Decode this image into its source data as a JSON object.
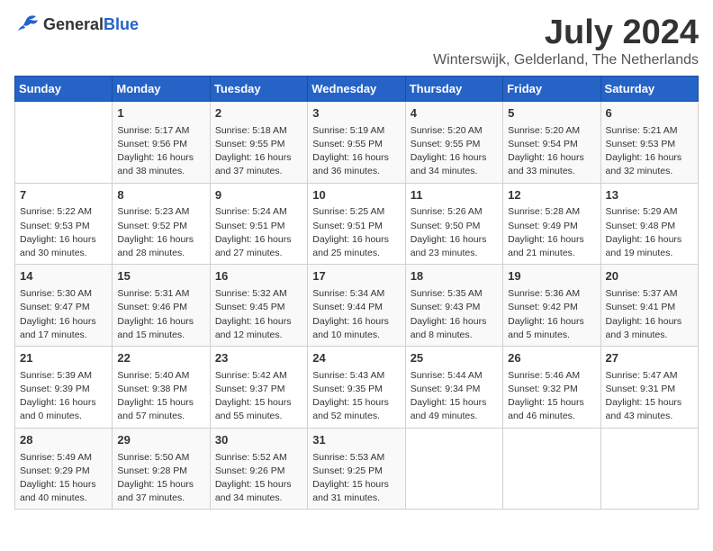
{
  "logo": {
    "general": "General",
    "blue": "Blue"
  },
  "title": "July 2024",
  "subtitle": "Winterswijk, Gelderland, The Netherlands",
  "days_header": [
    "Sunday",
    "Monday",
    "Tuesday",
    "Wednesday",
    "Thursday",
    "Friday",
    "Saturday"
  ],
  "weeks": [
    [
      {
        "day": "",
        "info": ""
      },
      {
        "day": "1",
        "info": "Sunrise: 5:17 AM\nSunset: 9:56 PM\nDaylight: 16 hours\nand 38 minutes."
      },
      {
        "day": "2",
        "info": "Sunrise: 5:18 AM\nSunset: 9:55 PM\nDaylight: 16 hours\nand 37 minutes."
      },
      {
        "day": "3",
        "info": "Sunrise: 5:19 AM\nSunset: 9:55 PM\nDaylight: 16 hours\nand 36 minutes."
      },
      {
        "day": "4",
        "info": "Sunrise: 5:20 AM\nSunset: 9:55 PM\nDaylight: 16 hours\nand 34 minutes."
      },
      {
        "day": "5",
        "info": "Sunrise: 5:20 AM\nSunset: 9:54 PM\nDaylight: 16 hours\nand 33 minutes."
      },
      {
        "day": "6",
        "info": "Sunrise: 5:21 AM\nSunset: 9:53 PM\nDaylight: 16 hours\nand 32 minutes."
      }
    ],
    [
      {
        "day": "7",
        "info": "Sunrise: 5:22 AM\nSunset: 9:53 PM\nDaylight: 16 hours\nand 30 minutes."
      },
      {
        "day": "8",
        "info": "Sunrise: 5:23 AM\nSunset: 9:52 PM\nDaylight: 16 hours\nand 28 minutes."
      },
      {
        "day": "9",
        "info": "Sunrise: 5:24 AM\nSunset: 9:51 PM\nDaylight: 16 hours\nand 27 minutes."
      },
      {
        "day": "10",
        "info": "Sunrise: 5:25 AM\nSunset: 9:51 PM\nDaylight: 16 hours\nand 25 minutes."
      },
      {
        "day": "11",
        "info": "Sunrise: 5:26 AM\nSunset: 9:50 PM\nDaylight: 16 hours\nand 23 minutes."
      },
      {
        "day": "12",
        "info": "Sunrise: 5:28 AM\nSunset: 9:49 PM\nDaylight: 16 hours\nand 21 minutes."
      },
      {
        "day": "13",
        "info": "Sunrise: 5:29 AM\nSunset: 9:48 PM\nDaylight: 16 hours\nand 19 minutes."
      }
    ],
    [
      {
        "day": "14",
        "info": "Sunrise: 5:30 AM\nSunset: 9:47 PM\nDaylight: 16 hours\nand 17 minutes."
      },
      {
        "day": "15",
        "info": "Sunrise: 5:31 AM\nSunset: 9:46 PM\nDaylight: 16 hours\nand 15 minutes."
      },
      {
        "day": "16",
        "info": "Sunrise: 5:32 AM\nSunset: 9:45 PM\nDaylight: 16 hours\nand 12 minutes."
      },
      {
        "day": "17",
        "info": "Sunrise: 5:34 AM\nSunset: 9:44 PM\nDaylight: 16 hours\nand 10 minutes."
      },
      {
        "day": "18",
        "info": "Sunrise: 5:35 AM\nSunset: 9:43 PM\nDaylight: 16 hours\nand 8 minutes."
      },
      {
        "day": "19",
        "info": "Sunrise: 5:36 AM\nSunset: 9:42 PM\nDaylight: 16 hours\nand 5 minutes."
      },
      {
        "day": "20",
        "info": "Sunrise: 5:37 AM\nSunset: 9:41 PM\nDaylight: 16 hours\nand 3 minutes."
      }
    ],
    [
      {
        "day": "21",
        "info": "Sunrise: 5:39 AM\nSunset: 9:39 PM\nDaylight: 16 hours\nand 0 minutes."
      },
      {
        "day": "22",
        "info": "Sunrise: 5:40 AM\nSunset: 9:38 PM\nDaylight: 15 hours\nand 57 minutes."
      },
      {
        "day": "23",
        "info": "Sunrise: 5:42 AM\nSunset: 9:37 PM\nDaylight: 15 hours\nand 55 minutes."
      },
      {
        "day": "24",
        "info": "Sunrise: 5:43 AM\nSunset: 9:35 PM\nDaylight: 15 hours\nand 52 minutes."
      },
      {
        "day": "25",
        "info": "Sunrise: 5:44 AM\nSunset: 9:34 PM\nDaylight: 15 hours\nand 49 minutes."
      },
      {
        "day": "26",
        "info": "Sunrise: 5:46 AM\nSunset: 9:32 PM\nDaylight: 15 hours\nand 46 minutes."
      },
      {
        "day": "27",
        "info": "Sunrise: 5:47 AM\nSunset: 9:31 PM\nDaylight: 15 hours\nand 43 minutes."
      }
    ],
    [
      {
        "day": "28",
        "info": "Sunrise: 5:49 AM\nSunset: 9:29 PM\nDaylight: 15 hours\nand 40 minutes."
      },
      {
        "day": "29",
        "info": "Sunrise: 5:50 AM\nSunset: 9:28 PM\nDaylight: 15 hours\nand 37 minutes."
      },
      {
        "day": "30",
        "info": "Sunrise: 5:52 AM\nSunset: 9:26 PM\nDaylight: 15 hours\nand 34 minutes."
      },
      {
        "day": "31",
        "info": "Sunrise: 5:53 AM\nSunset: 9:25 PM\nDaylight: 15 hours\nand 31 minutes."
      },
      {
        "day": "",
        "info": ""
      },
      {
        "day": "",
        "info": ""
      },
      {
        "day": "",
        "info": ""
      }
    ]
  ]
}
